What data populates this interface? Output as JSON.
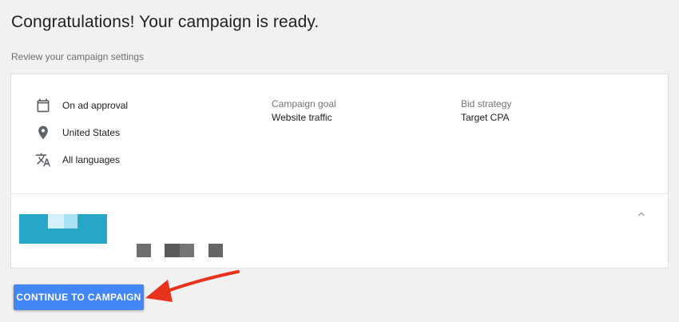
{
  "header": {
    "title": "Congratulations! Your campaign is ready.",
    "subtitle": "Review your campaign settings"
  },
  "settings": {
    "items": [
      {
        "icon": "calendar-icon",
        "label": "On ad approval"
      },
      {
        "icon": "location-pin-icon",
        "label": "United States"
      },
      {
        "icon": "translate-icon",
        "label": "All languages"
      }
    ],
    "campaign_goal": {
      "label": "Campaign goal",
      "value": "Website traffic"
    },
    "bid_strategy": {
      "label": "Bid strategy",
      "value": "Target CPA"
    }
  },
  "actions": {
    "continue_label": "CONTINUE TO CAMPAIGN"
  },
  "colors": {
    "primary_button": "#4285f4",
    "annotation_arrow": "#e8331c",
    "redacted_logo": "#27a6c8"
  }
}
